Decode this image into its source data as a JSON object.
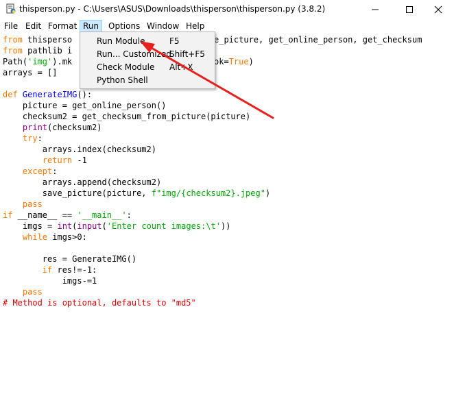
{
  "window": {
    "title": "thisperson.py - C:\\Users\\ASUS\\Downloads\\thisperson\\thisperson.py (3.8.2)",
    "minimize_glyph": "—",
    "maximize_glyph": "☐",
    "close_glyph": "✕",
    "icon": "python-idle-icon"
  },
  "menubar": {
    "items": [
      {
        "label": "File"
      },
      {
        "label": "Edit"
      },
      {
        "label": "Format"
      },
      {
        "label": "Run"
      },
      {
        "label": "Options"
      },
      {
        "label": "Window"
      },
      {
        "label": "Help"
      }
    ]
  },
  "run_menu": {
    "items": [
      {
        "label": "Run Module",
        "accel": "F5"
      },
      {
        "label": "Run... Customized",
        "accel": "Shift+F5"
      },
      {
        "label": "Check Module",
        "accel": "Alt+X"
      },
      {
        "label": "Python Shell",
        "accel": ""
      }
    ]
  },
  "code": {
    "line1_kw": "from",
    "line1_text": " thisperso",
    "line1_tail": "e_picture, get_online_person, get_checksum",
    "line2_kw": "from",
    "line2_text": " pathlib i",
    "line3_a": "Path(",
    "line3_str": "'img'",
    "line3_b": ").mk",
    "line3_c": "ok=",
    "line3_kw": "True",
    "line3_d": ")",
    "line4": "arrays = []",
    "line6_kw": "def",
    "line6_name": " GenerateIMG",
    "line6_rest": "():",
    "line7": "    picture = get_online_person()",
    "line8": "    checksum2 = get_checksum_from_picture(picture)",
    "line9_indent": "    ",
    "line9_bi": "print",
    "line9_rest": "(checksum2)",
    "line10_indent": "    ",
    "line10_kw": "try",
    "line10_rest": ":",
    "line11": "        arrays.index(checksum2)",
    "line12_indent": "        ",
    "line12_kw": "return",
    "line12_rest": " -1",
    "line13_indent": "    ",
    "line13_kw": "except",
    "line13_rest": ":",
    "line14": "        arrays.append(checksum2)",
    "line15_a": "        save_picture(picture, ",
    "line15_str": "f\"img/{checksum2}.jpeg\"",
    "line15_b": ")",
    "line16_indent": "    ",
    "line16_kw": "pass",
    "line17_kw": "if",
    "line17_a": " __name__ == ",
    "line17_str": "'__main__'",
    "line17_b": ":",
    "line18_a": "    imgs = ",
    "line18_bi1": "int",
    "line18_b": "(",
    "line18_bi2": "input",
    "line18_c": "(",
    "line18_str": "'Enter count images:\\t'",
    "line18_d": "))",
    "line19_indent": "    ",
    "line19_kw": "while",
    "line19_rest": " imgs>0:",
    "line21": "        res = GenerateIMG()",
    "line22_indent": "        ",
    "line22_kw": "if",
    "line22_rest": " res!=-1:",
    "line23": "            imgs-=1",
    "line24_indent": "    ",
    "line24_kw": "pass",
    "line25": "# Method is optional, defaults to \"md5\""
  },
  "colors": {
    "keyword": "#ff7700",
    "string": "#00aa00",
    "builtin": "#900090",
    "definition": "#0000ff",
    "comment": "#dd0000",
    "annotation_arrow": "#e8211e",
    "menu_highlight": "#cce8ff"
  },
  "annotation": {
    "type": "arrow",
    "points_to": "Run Module"
  }
}
